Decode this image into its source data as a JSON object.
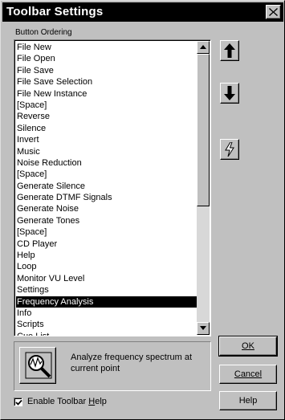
{
  "window": {
    "title": "Toolbar Settings",
    "close_icon": "close-icon"
  },
  "button_ordering": {
    "label": "Button Ordering",
    "items": [
      "File New",
      "File Open",
      "File Save",
      "File Save Selection",
      "File New Instance",
      "[Space]",
      "Reverse",
      "Silence",
      "Invert",
      "Music",
      "Noise Reduction",
      "[Space]",
      "Generate Silence",
      "Generate DTMF Signals",
      "Generate Noise",
      "Generate Tones",
      "[Space]",
      "CD Player",
      "Help",
      "Loop",
      "Monitor VU Level",
      "Settings",
      "Frequency Analysis",
      "Info",
      "Scripts",
      "Cue List"
    ],
    "selected_index": 22
  },
  "side_buttons": {
    "move_up_icon": "arrow-up-icon",
    "move_down_icon": "arrow-down-icon",
    "lightning_icon": "lightning-icon"
  },
  "help_panel": {
    "icon": "frequency-analysis-icon",
    "text": "Analyze frequency spectrum at current point"
  },
  "actions": {
    "ok_label": "OK",
    "cancel_label": "Cancel",
    "help_label": "Help"
  },
  "options": {
    "enable_toolbar_help_prefix": "Enable Toolbar ",
    "enable_toolbar_help_accel": "H",
    "enable_toolbar_help_suffix": "elp",
    "enable_toolbar_help_checked": true
  }
}
